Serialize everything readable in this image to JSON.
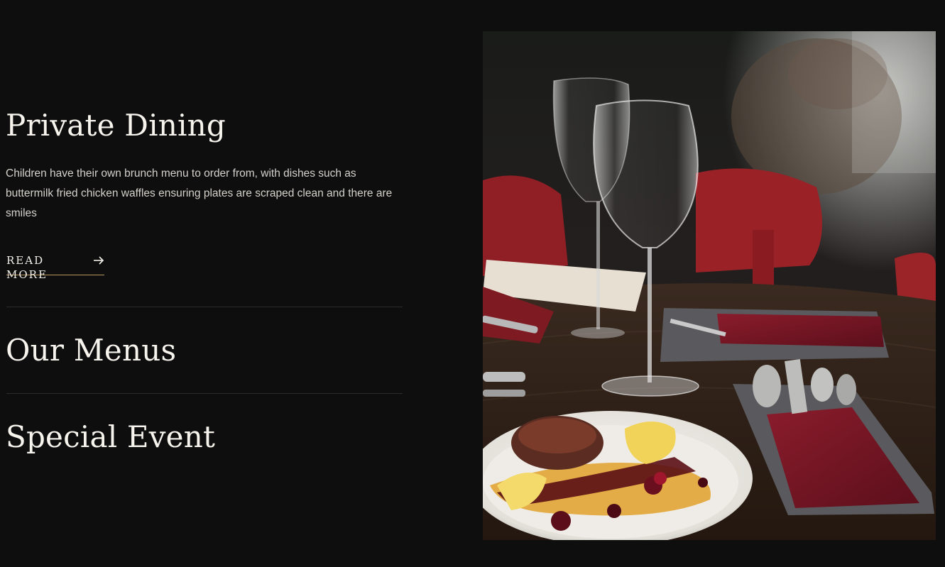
{
  "sections": {
    "private_dining": {
      "title": "Private Dining",
      "description": "Children have their own brunch menu to order from, with dishes such as buttermilk fried chicken waffles ensuring plates are scraped clean and there are smiles",
      "read_more_label": "READ MORE",
      "read_more_icon": "arrow-right-icon"
    },
    "our_menus": {
      "title": "Our Menus"
    },
    "special_event": {
      "title": "Special Event"
    }
  },
  "image": {
    "subject": "restaurant-table-setting-photo",
    "alt": ""
  },
  "colors": {
    "background": "#0e0e0f",
    "heading": "#f7f4ee",
    "body_text": "#d5d2cc",
    "accent_underline": "#b8985e",
    "divider": "#2b2b2d"
  }
}
